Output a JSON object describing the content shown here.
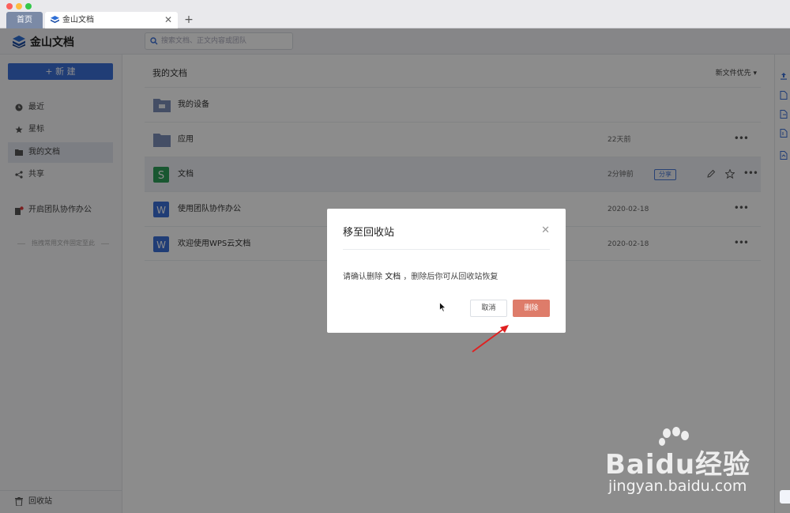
{
  "window": {
    "tabs": [
      {
        "label": "首页"
      },
      {
        "label": "金山文档"
      }
    ],
    "new_tab": "+"
  },
  "header": {
    "brand": "金山文档",
    "search_placeholder": "搜索文档、正文内容或团队"
  },
  "sidebar": {
    "new_button": "+ 新 建",
    "items": [
      {
        "label": "最近",
        "icon": "clock-icon"
      },
      {
        "label": "星标",
        "icon": "star-icon"
      },
      {
        "label": "我的文档",
        "icon": "folder-icon",
        "active": true
      },
      {
        "label": "共享",
        "icon": "share-icon"
      },
      {
        "label": "开启团队协作办公",
        "icon": "team-icon"
      }
    ],
    "pin_hint": "拖拽常用文件固定至此",
    "recycle_bin": "回收站"
  },
  "main": {
    "title": "我的文档",
    "sort": "新文件优先 ▾",
    "rows": [
      {
        "name": "我的设备",
        "icon": "device-folder-icon",
        "date": "",
        "more": false
      },
      {
        "name": "应用",
        "icon": "folder-icon",
        "date": "22天前",
        "more": true
      },
      {
        "name": "文档",
        "icon": "sheet-doc-icon",
        "date": "2分钟前",
        "badge": "分享",
        "more": true,
        "highlighted": true
      },
      {
        "name": "使用团队协作办公",
        "icon": "word-doc-icon",
        "date": "2020-02-18",
        "more": true
      },
      {
        "name": "欢迎使用WPS云文档",
        "icon": "word-doc-icon",
        "date": "2020-02-18",
        "more": true
      }
    ]
  },
  "dialog": {
    "title": "移至回收站",
    "message_prefix": "请确认删除",
    "message_file": "文档",
    "message_suffix": "，删除后你可从回收站恢复",
    "cancel": "取消",
    "delete": "删除"
  },
  "watermark": {
    "brand": "Baidu经验",
    "url": "jingyan.baidu.com"
  },
  "colors": {
    "accent": "#3b6fd8",
    "delete_button": "#de7c6a",
    "annotation_arrow": "#e02020"
  }
}
